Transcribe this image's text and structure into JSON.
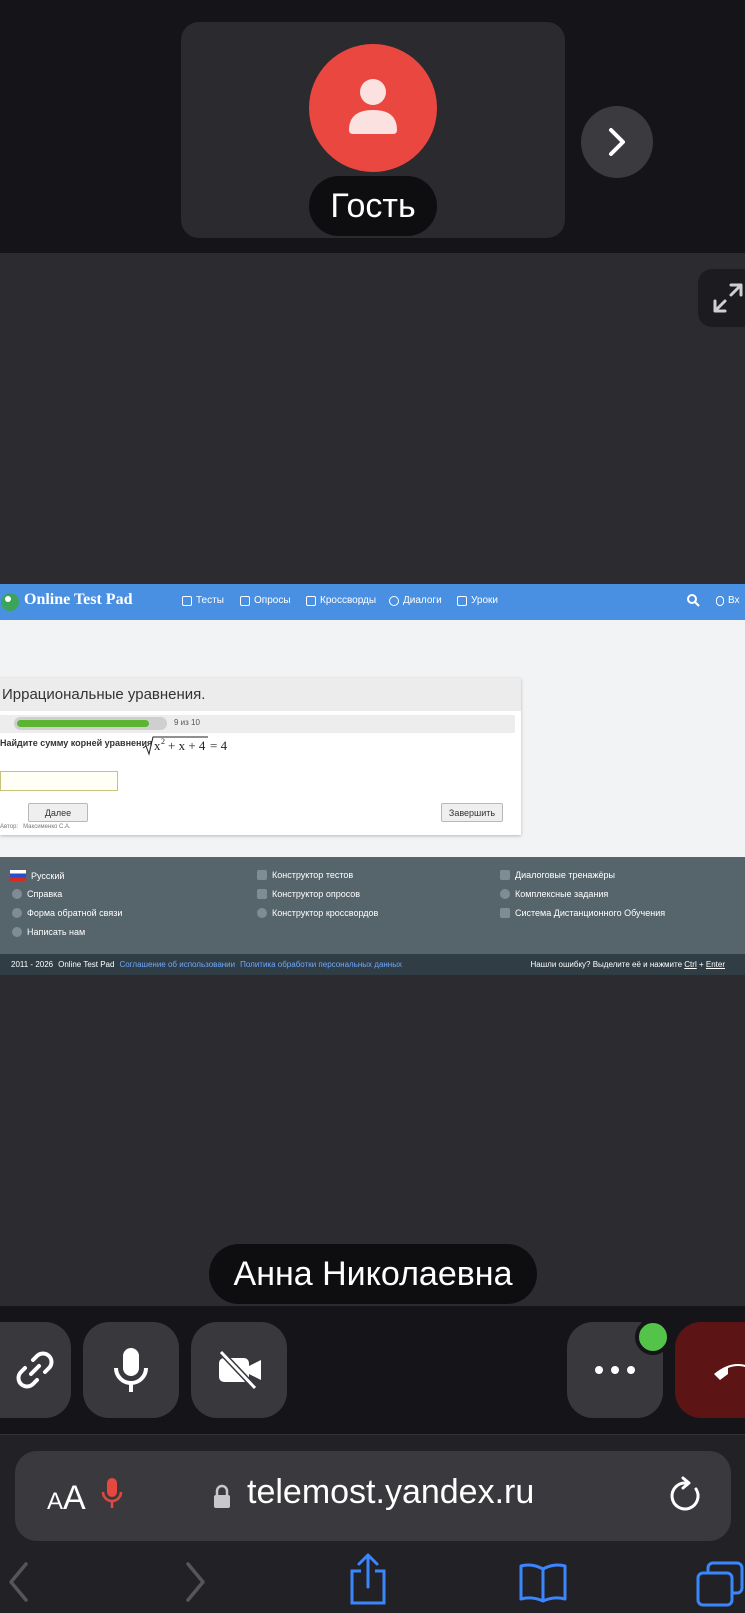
{
  "guest": {
    "name": "Гость"
  },
  "speaker": {
    "name": "Анна Николаевна"
  },
  "shared_screen": {
    "site_name": "Online Test Pad",
    "nav": [
      "Тесты",
      "Опросы",
      "Кроссворды",
      "Диалоги",
      "Уроки"
    ],
    "login_label": "Вх",
    "test": {
      "title": "Иррациональные уравнения.",
      "progress_text": "9 из 10",
      "progress_fraction": 0.9,
      "question": "Найдите сумму корней уравнения",
      "equation": "√(x² + x + 4) = 4",
      "answer_value": "",
      "next_label": "Далее",
      "finish_label": "Завершить",
      "author_label": "Автор:",
      "author_name": "Максименко С.А."
    },
    "footer": {
      "col1": [
        "Русский",
        "Справка",
        "Форма обратной связи",
        "Написать нам"
      ],
      "col2": [
        "Конструктор тестов",
        "Конструктор опросов",
        "Конструктор кроссвордов"
      ],
      "col3": [
        "Диалоговые тренажёры",
        "Комплексные задания",
        "Система Дистанционного Обучения"
      ],
      "years": "2011 - 2026",
      "brand": "Online Test Pad",
      "link1": "Соглашение об использовании",
      "link2": "Политика обработки персональных данных",
      "error_hint": "Нашли ошибку? Выделите её и нажмите",
      "key1": "Ctrl",
      "plus": "+",
      "key2": "Enter"
    }
  },
  "browser": {
    "aa_small": "A",
    "aa_large": "A",
    "url": "telemost.yandex.ru"
  },
  "colors": {
    "avatar": "#e9473f",
    "hangup": "#5c1414",
    "status_dot": "#53c449",
    "otp_header": "#4a90e2",
    "progress": "#5cb531"
  }
}
